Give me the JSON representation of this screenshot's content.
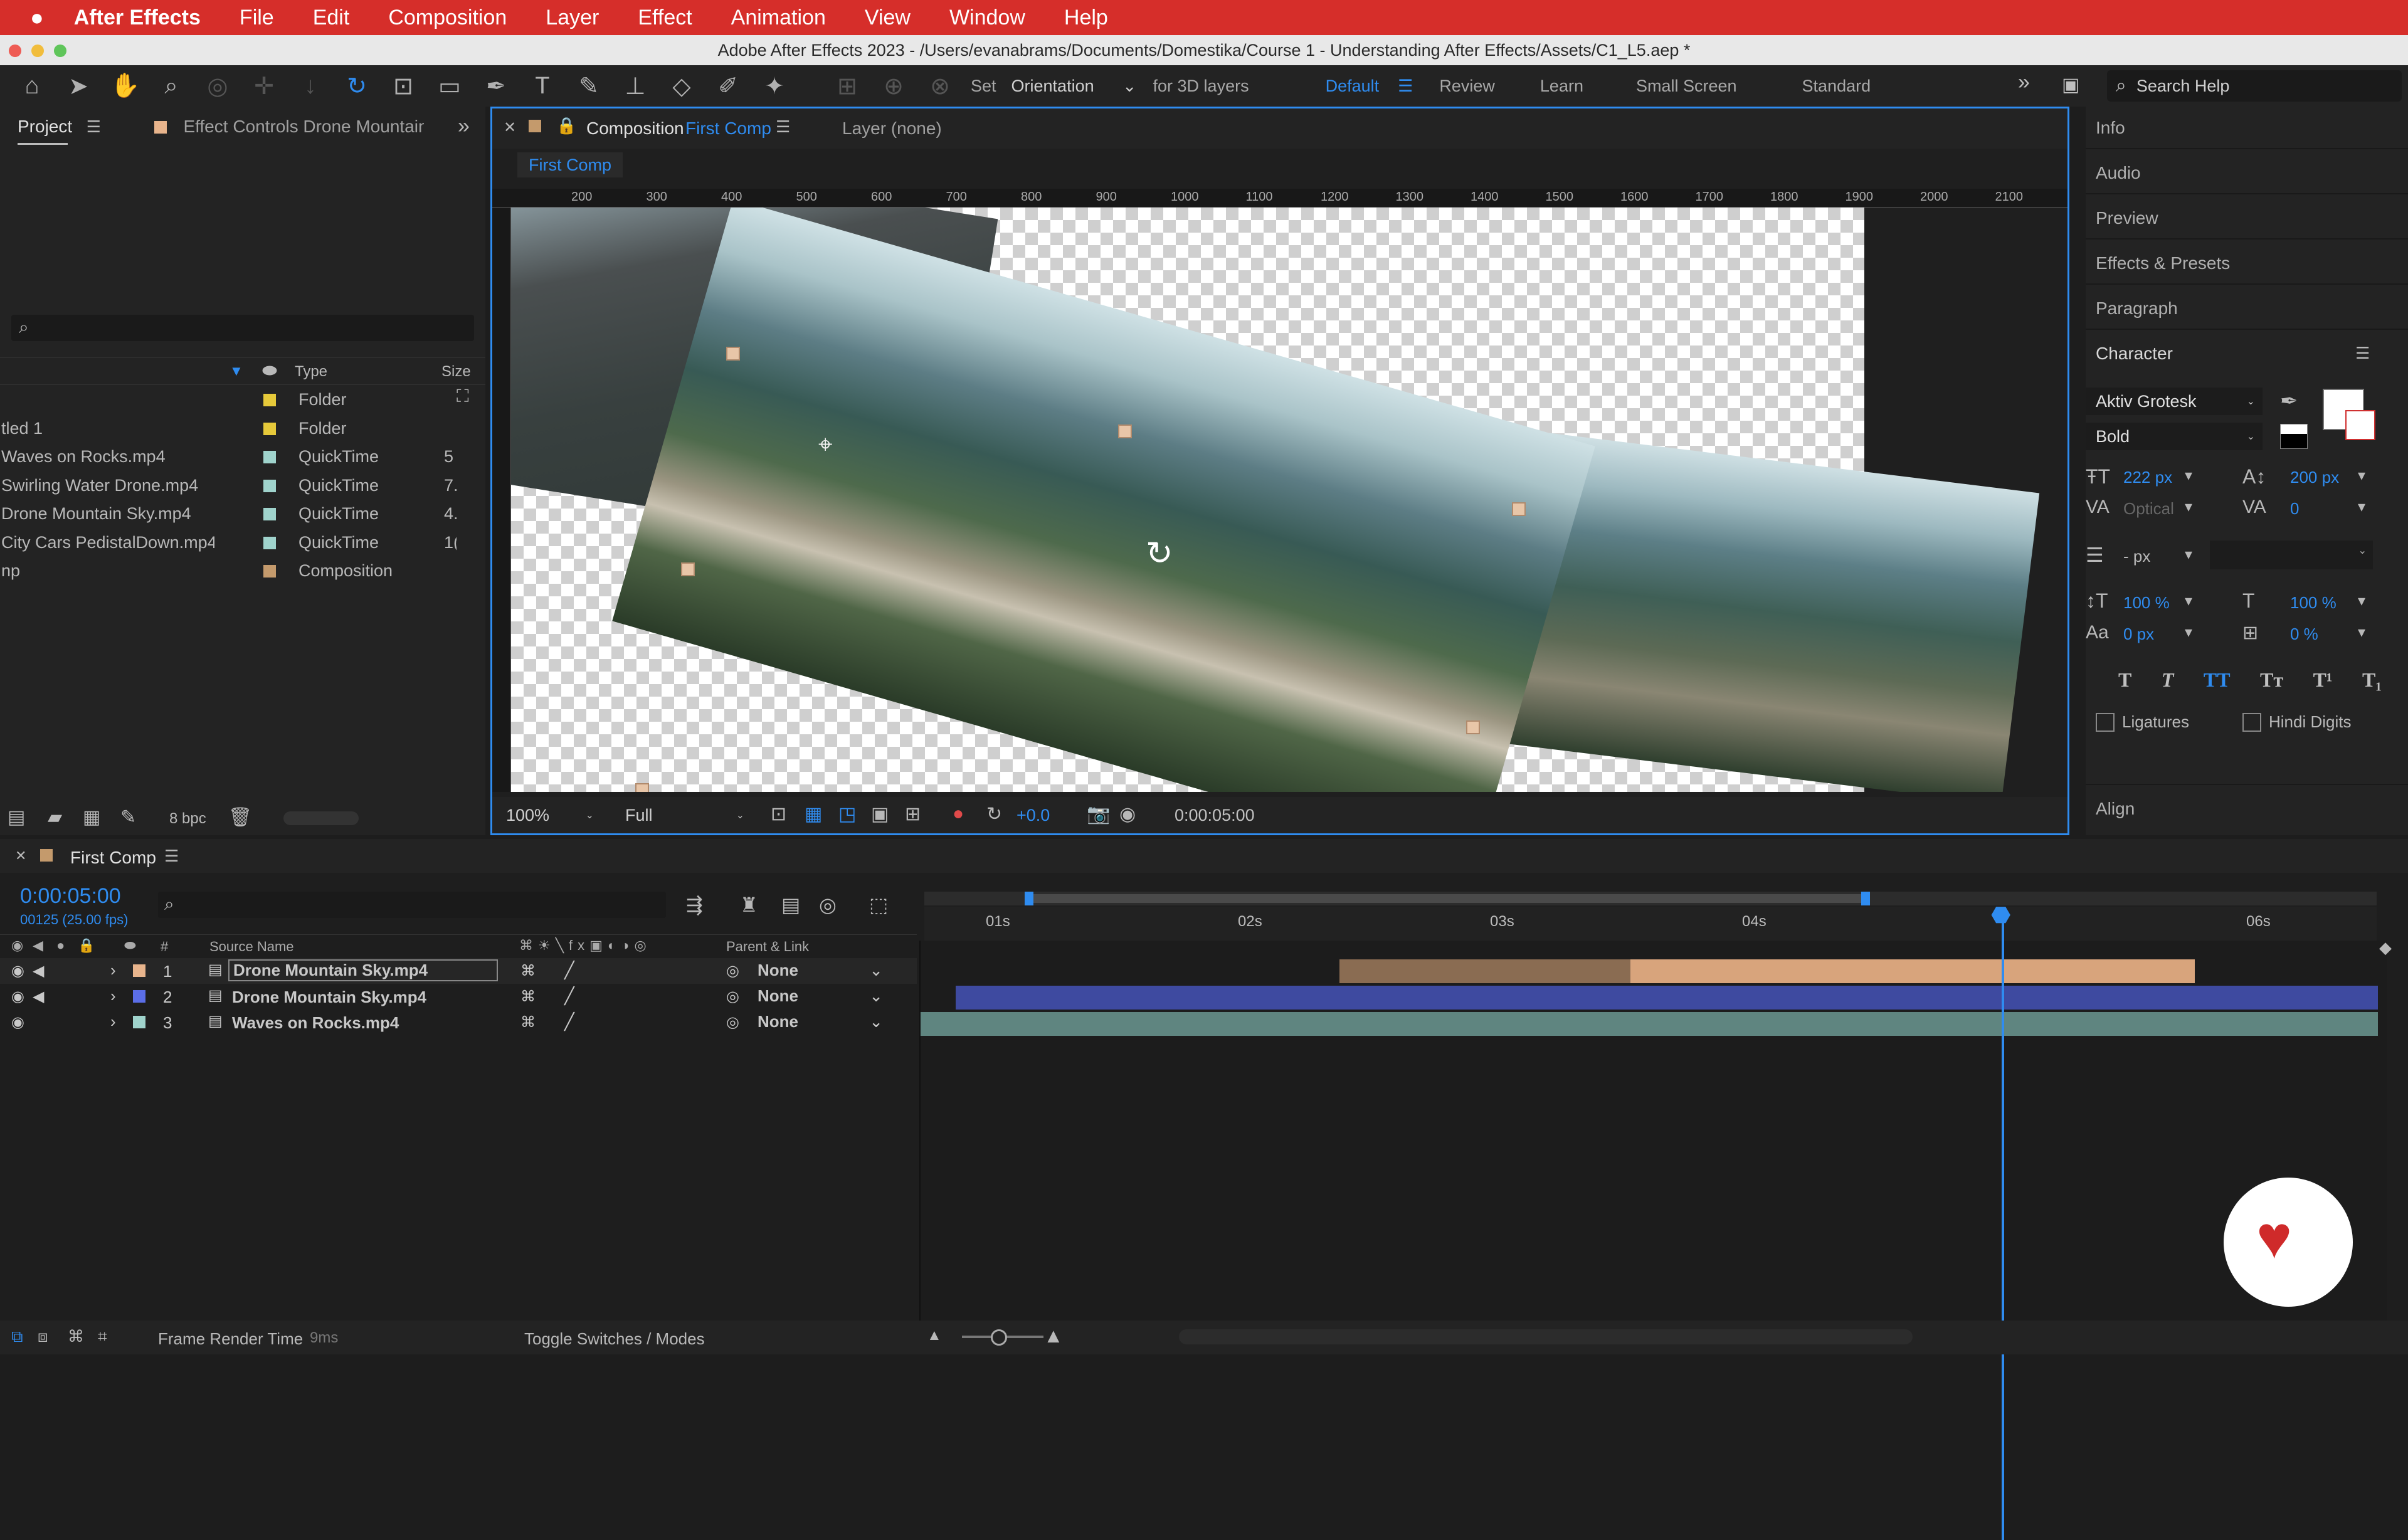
{
  "menubar": {
    "app_name": "After Effects",
    "items": [
      "File",
      "Edit",
      "Composition",
      "Layer",
      "Effect",
      "Animation",
      "View",
      "Window",
      "Help"
    ]
  },
  "window_title": "Adobe After Effects 2023 - /Users/evanabrams/Documents/Domestika/Course 1 - Understanding After Effects/Assets/C1_L5.aep *",
  "toolbar": {
    "set_label": "Set",
    "orientation_value": "Orientation",
    "for3d_label": "for 3D layers",
    "workspaces": [
      "Default",
      "Review",
      "Learn",
      "Small Screen",
      "Standard"
    ],
    "active_workspace": "Default",
    "search_placeholder": "Search Help"
  },
  "project_panel": {
    "tab_project": "Project",
    "tab_effect_controls": "Effect Controls Drone Mountain :",
    "col_type": "Type",
    "col_size": "Size",
    "items": [
      {
        "name": "",
        "type": "Folder",
        "size": "",
        "color": "#e6c93a"
      },
      {
        "name": "tled 1",
        "type": "Folder",
        "size": "",
        "color": "#e6c93a"
      },
      {
        "name": "Waves on Rocks.mp4",
        "type": "QuickTime",
        "size": "5",
        "color": "#9fd3cc"
      },
      {
        "name": "Swirling Water Drone.mp4",
        "type": "QuickTime",
        "size": "7.",
        "color": "#9fd3cc"
      },
      {
        "name": "Drone Mountain Sky.mp4",
        "type": "QuickTime",
        "size": "4.",
        "color": "#9fd3cc"
      },
      {
        "name": "City Cars PedistalDown.mp4",
        "type": "QuickTime",
        "size": "1(",
        "color": "#9fd3cc"
      },
      {
        "name": "np",
        "type": "Composition",
        "size": "",
        "color": "#c49a6c"
      }
    ],
    "bpc": "8 bpc"
  },
  "comp_panel": {
    "tab_label": "Composition",
    "tab_comp_name": "First Comp",
    "layer_label": "Layer (none)",
    "breadcrumb": "First Comp",
    "ruler_labels": [
      "200",
      "300",
      "400",
      "500",
      "600",
      "700",
      "800",
      "900",
      "1000",
      "1100",
      "1200",
      "1300",
      "1400",
      "1500",
      "1600",
      "1700",
      "1800",
      "1900",
      "2000",
      "2100"
    ],
    "zoom": "100%",
    "resolution": "Full",
    "exposure": "+0.0",
    "timecode": "0:00:05:00"
  },
  "right_panel": {
    "items": [
      "Info",
      "Audio",
      "Preview",
      "Effects & Presets",
      "Paragraph"
    ],
    "character_title": "Character",
    "font_family": "Aktiv Grotesk",
    "font_style": "Bold",
    "font_size": "222 px",
    "leading": "200 px",
    "kerning": "Optical",
    "tracking": "0",
    "stroke_width": "- px",
    "vert_scale": "100 %",
    "horiz_scale": "100 %",
    "baseline_shift": "0 px",
    "tsume": "0 %",
    "ligatures": "Ligatures",
    "hindi_digits": "Hindi Digits",
    "align_title": "Align"
  },
  "timeline": {
    "comp_tab": "First Comp",
    "timecode": "0:00:05:00",
    "frame_info": "00125 (25.00 fps)",
    "col_hash": "#",
    "col_source_name": "Source Name",
    "col_parent": "Parent & Link",
    "time_labels": [
      "01s",
      "02s",
      "03s",
      "04s",
      "06s"
    ],
    "layers": [
      {
        "num": "1",
        "name": "Drone Mountain Sky.mp4",
        "parent": "None",
        "label_color": "#e8b48c"
      },
      {
        "num": "2",
        "name": "Drone Mountain Sky.mp4",
        "parent": "None",
        "label_color": "#5b6ee8"
      },
      {
        "num": "3",
        "name": "Waves on Rocks.mp4",
        "parent": "None",
        "label_color": "#9fd3cc"
      }
    ],
    "frame_render_label": "Frame Render Time",
    "frame_render_value": "9ms",
    "toggle_label": "Toggle Switches / Modes"
  },
  "colors": {
    "accent": "#2f8cf0",
    "menubar": "#d62e2a",
    "layer2_bar": "#3e4aa0",
    "layer3_bar": "#5f8580",
    "layer1_bar": "#c99a72"
  }
}
